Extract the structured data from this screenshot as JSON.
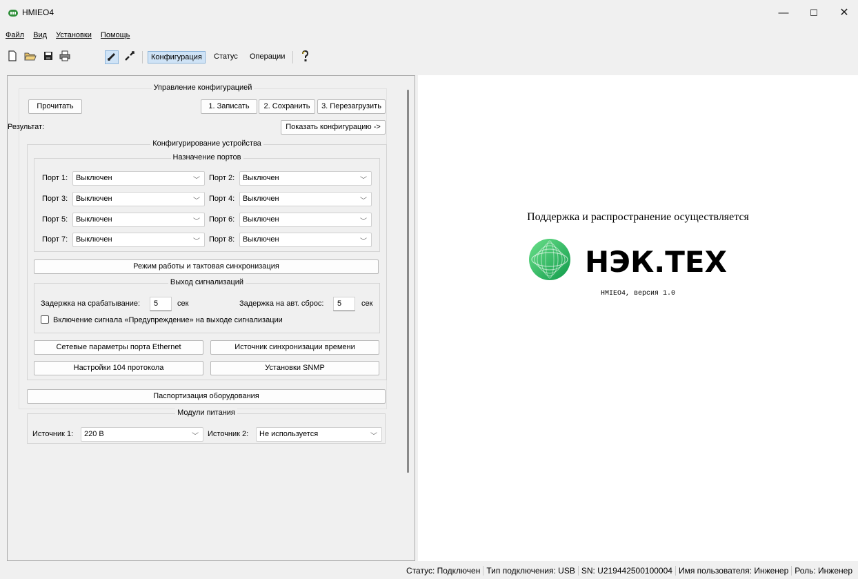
{
  "window": {
    "title": "HMIEO4",
    "min_glyph": "—",
    "max_glyph": "☐",
    "close_glyph": "✕"
  },
  "menu": [
    "Файл",
    "Вид",
    "Установки",
    "Помощь"
  ],
  "toolbar": {
    "icons": [
      "new-file-icon",
      "open-folder-icon",
      "save-icon",
      "print-icon",
      "connect-icon",
      "disconnect-icon",
      "help-icon"
    ],
    "tabs": [
      "Конфигурация",
      "Статус",
      "Операции"
    ],
    "active_tab": "Конфигурация"
  },
  "config_mgmt": {
    "title": "Управление конфигурацией",
    "read_button": "Прочитать",
    "write_button": "1. Записать",
    "save_button": "2. Сохранить",
    "reboot_button": "3. Перезагрузить",
    "result_label": "Результат:",
    "show_config_button": "Показать конфигурацию ->"
  },
  "device_config": {
    "title": "Конфигурирование устройства",
    "ports_title": "Назначение портов",
    "ports": [
      {
        "label": "Порт 1:",
        "value": "Выключен"
      },
      {
        "label": "Порт 2:",
        "value": "Выключен"
      },
      {
        "label": "Порт 3:",
        "value": "Выключен"
      },
      {
        "label": "Порт 4:",
        "value": "Выключен"
      },
      {
        "label": "Порт 5:",
        "value": "Выключен"
      },
      {
        "label": "Порт 6:",
        "value": "Выключен"
      },
      {
        "label": "Порт 7:",
        "value": "Выключен"
      },
      {
        "label": "Порт 8:",
        "value": "Выключен"
      }
    ],
    "mode_button": "Режим работы и тактовая синхронизация",
    "alarm": {
      "title": "Выход сигнализаций",
      "delay_trigger_label": "Задержка на срабатывание:",
      "delay_trigger_value": "5",
      "delay_trigger_unit": "сек",
      "delay_reset_label": "Задержка на авт. сброс:",
      "delay_reset_value": "5",
      "delay_reset_unit": "сек",
      "warning_checkbox_label": "Включение сигнала «Предупреждение» на выходе сигнализации",
      "warning_checked": false
    },
    "ethernet_button": "Сетевые параметры порта Ethernet",
    "time_sync_button": "Источник синхронизации времени",
    "protocol104_button": "Настройки 104 протокола",
    "snmp_button": "Установки SNMP"
  },
  "passport_button": "Паспортизация оборудования",
  "power": {
    "title": "Модули питания",
    "source1_label": "Источник 1:",
    "source1_value": "220 В",
    "source2_label": "Источник 2:",
    "source2_value": "Не используется"
  },
  "about": {
    "support_text": "Поддержка и распространение осуществляется",
    "brand": "НЭК.ТЕХ",
    "version": "HMIEO4, версия 1.0",
    "brand_color": "#1fae5b"
  },
  "status": {
    "status": "Статус: Подключен",
    "connection": "Тип подключения: USB",
    "sn": "SN: U219442500100004",
    "user": "Имя пользователя: Инженер",
    "role": "Роль: Инженер"
  }
}
